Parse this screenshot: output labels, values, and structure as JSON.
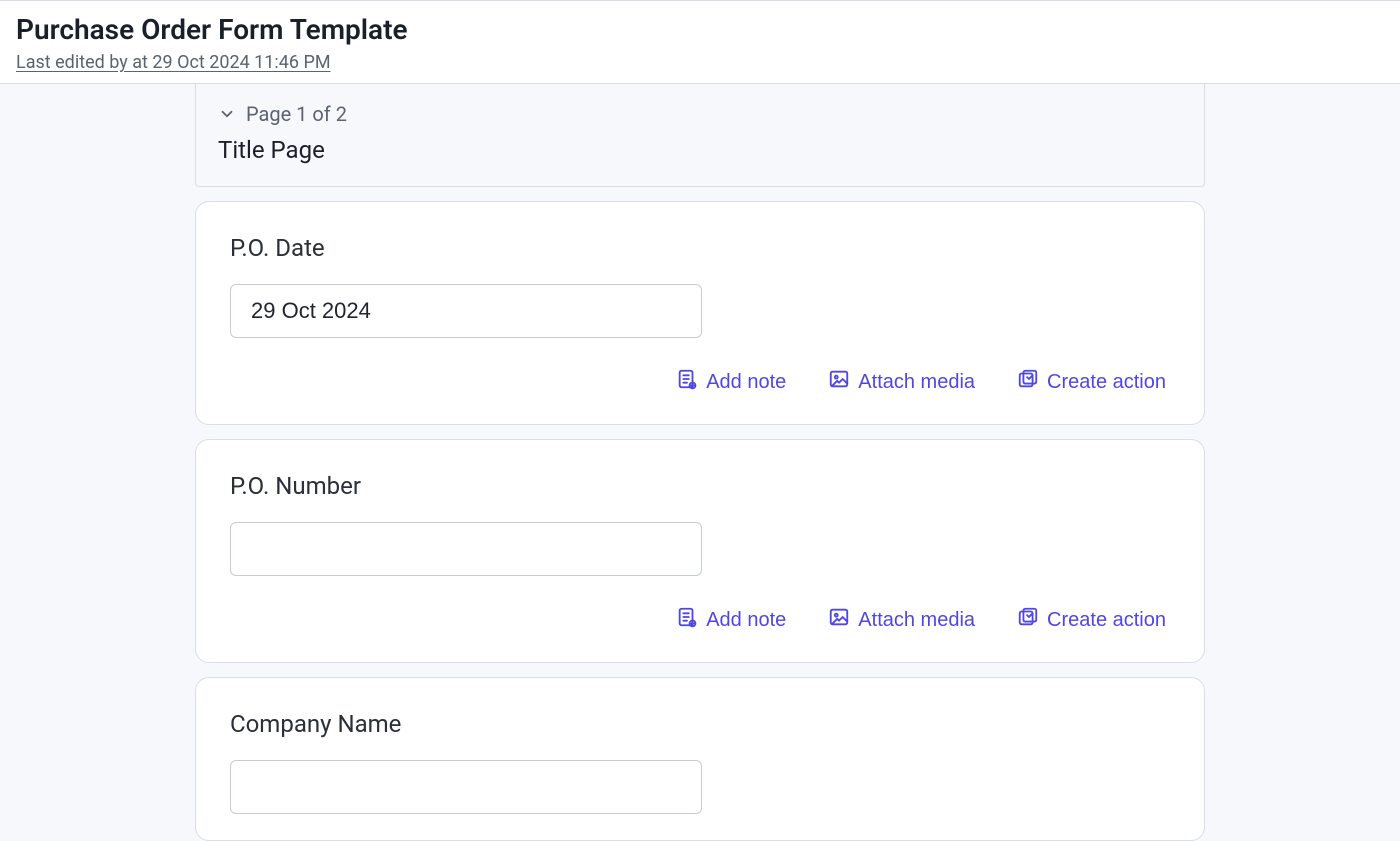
{
  "header": {
    "title": "Purchase Order Form Template",
    "last_edited_prefix": "Last edited by ",
    "last_edited_by": "",
    "last_edited_suffix": " at 29 Oct 2024 11:46 PM"
  },
  "page_indicator": {
    "label": "Page 1 of 2",
    "subtitle": "Title Page"
  },
  "fields": [
    {
      "label": "P.O. Date",
      "value": "29 Oct 2024"
    },
    {
      "label": "P.O. Number",
      "value": ""
    },
    {
      "label": "Company Name",
      "value": ""
    }
  ],
  "actions": {
    "add_note": "Add note",
    "attach_media": "Attach media",
    "create_action": "Create action"
  }
}
